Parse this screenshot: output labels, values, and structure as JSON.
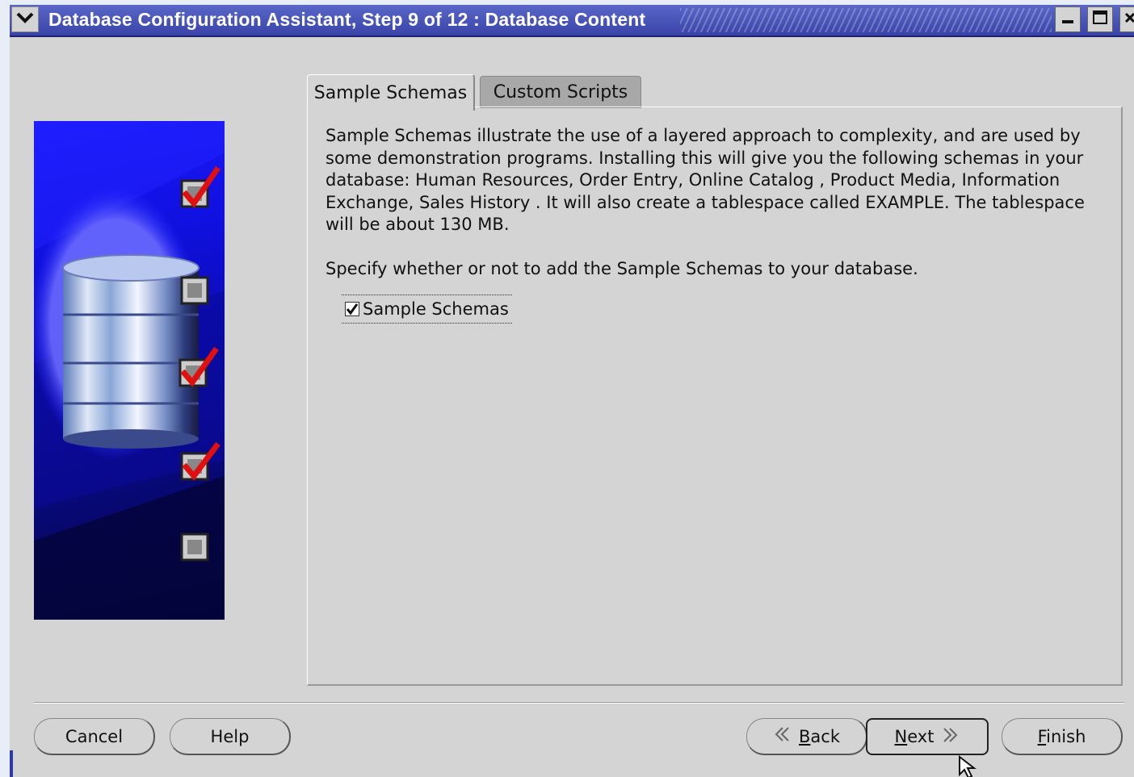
{
  "window": {
    "title": "Database Configuration Assistant, Step 9 of 12 : Database Content",
    "menu_icon": "chevron-down-icon",
    "minimize_icon": "minimize-icon",
    "maximize_icon": "maximize-icon",
    "close_icon": "close-icon"
  },
  "tabs": [
    {
      "label": "Sample Schemas",
      "active": true
    },
    {
      "label": "Custom Scripts",
      "active": false
    }
  ],
  "content": {
    "description": "Sample Schemas illustrate the use of a layered approach to complexity, and are used by some demonstration programs. Installing this will give you the following schemas in your database: Human Resources, Order Entry, Online Catalog , Product Media, Information Exchange, Sales History . It will also create a tablespace called EXAMPLE. The tablespace will be about 130 MB.",
    "prompt": "Specify whether or not to add the Sample Schemas to your database.",
    "checkbox_label": "Sample Schemas",
    "checkbox_checked": true
  },
  "buttons": {
    "cancel": "Cancel",
    "help": "Help",
    "back_mnemonic": "B",
    "back_rest": "ack",
    "next_mnemonic": "N",
    "next_rest": "ext",
    "finish_mnemonic": "F",
    "finish_rest": "inish"
  },
  "colors": {
    "title_bar": "#3a44a8",
    "dialog_bg": "#d4d4d4",
    "side_panel": "#1010e0",
    "check_red": "#e01010"
  }
}
